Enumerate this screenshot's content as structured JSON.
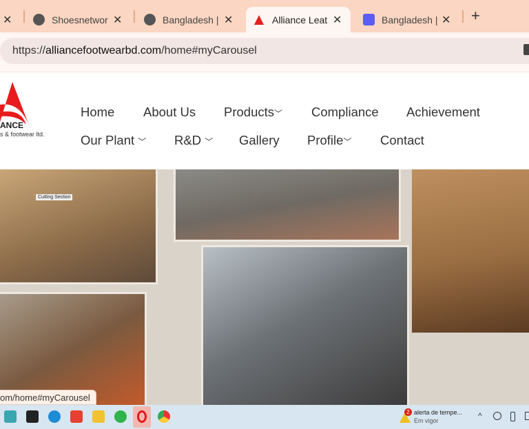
{
  "browser": {
    "tabs": [
      {
        "title": "Shoesnetwor",
        "icon": "globe-icon"
      },
      {
        "title": "Bangladesh |",
        "icon": "globe-icon"
      },
      {
        "title": "Alliance Leat",
        "icon": "alliance-logo-icon",
        "active": true
      },
      {
        "title": "Bangladesh |",
        "icon": "site-icon"
      }
    ],
    "new_tab": "+",
    "close": "✕",
    "url_prefix": "https://",
    "url_domain": "alliancefootwearbd.com",
    "url_path": "/home#myCarousel"
  },
  "site": {
    "logo_text": "ANCE",
    "logo_sub": "s & footwear ltd.",
    "nav": [
      "Home",
      "About Us",
      "Products",
      "Compliance",
      "Achievement",
      "Our Plant",
      "R&D",
      "Gallery",
      "Profile",
      "Contact"
    ],
    "photo_sign": "Cutting Section"
  },
  "status_url": "om/home#myCarousel",
  "taskbar": {
    "weather_title": "alerta de tempe...",
    "weather_sub": "Em vigor",
    "badge": "2"
  }
}
